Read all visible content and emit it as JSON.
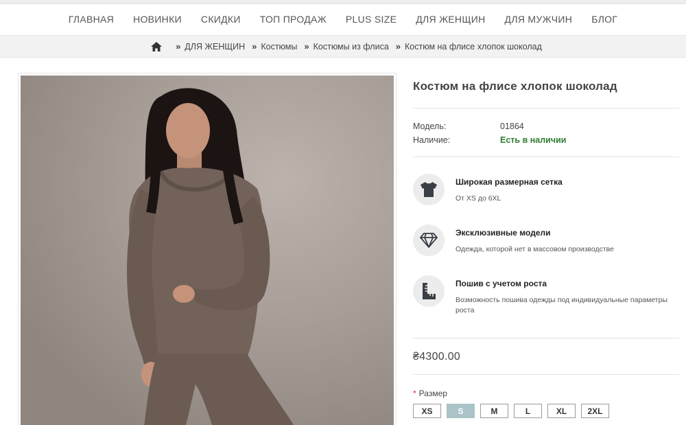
{
  "nav": {
    "items": [
      "ГЛАВНАЯ",
      "НОВИНКИ",
      "СКИДКИ",
      "ТОП ПРОДАЖ",
      "PLUS SIZE",
      "ДЛЯ ЖЕНЩИН",
      "ДЛЯ МУЖЧИН",
      "БЛОГ"
    ]
  },
  "breadcrumb": {
    "items": [
      "ДЛЯ ЖЕНЩИН",
      "Костюмы",
      "Костюмы из флиса",
      "Костюм на флисе хлопок шоколад"
    ]
  },
  "product": {
    "title": "Костюм на флисе хлопок шоколад",
    "specs": [
      {
        "label": "Модель:",
        "value": "01864"
      },
      {
        "label": "Наличие:",
        "value": "Есть в наличии"
      }
    ],
    "features": [
      {
        "icon": "tshirt-icon",
        "title": "Широкая размерная сетка",
        "desc": "От XS до 6XL"
      },
      {
        "icon": "diamond-icon",
        "title": "Эксклюзивные модели",
        "desc": "Одежда, которой нет в массовом производстве"
      },
      {
        "icon": "ruler-icon",
        "title": "Пошив с учетом роста",
        "desc": "Возможность пошива одежды под индивидуальные параметры роста"
      }
    ],
    "price": "₴4300.00",
    "size_label": "Размер",
    "required_mark": "*",
    "sizes": [
      "XS",
      "S",
      "M",
      "L",
      "XL",
      "2XL"
    ],
    "selected_size": "S"
  },
  "colors": {
    "in_stock": "#2e7d32",
    "selected_size_bg": "#a9c3c6",
    "required": "#d32f2f"
  }
}
